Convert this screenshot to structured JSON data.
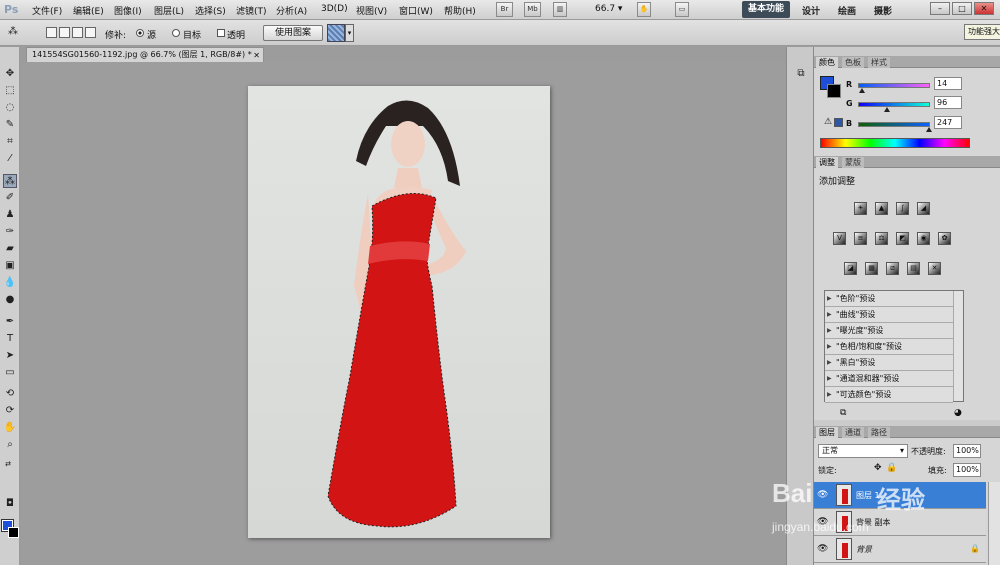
{
  "app": {
    "logo": "Ps"
  },
  "menu": [
    "文件(F)",
    "编辑(E)",
    "图像(I)",
    "图层(L)",
    "选择(S)",
    "滤镜(T)",
    "分析(A)",
    "3D(D)",
    "视图(V)",
    "窗口(W)",
    "帮助(H)"
  ],
  "menubar_icons": [
    "Br",
    "Mb"
  ],
  "zoom": "66.7",
  "workspaces": {
    "active": "基本功能",
    "others": [
      "设计",
      "绘画",
      "摄影"
    ]
  },
  "window_buttons": [
    "–",
    "□",
    "✕"
  ],
  "options": {
    "patch_label": "修补:",
    "source": "源",
    "target": "目标",
    "transparent": "透明",
    "use_pattern": "使用图案"
  },
  "tooltip": "功能强大",
  "document": {
    "tab": "141554SG01560-1192.jpg @ 66.7% (图层 1, RGB/8#) *",
    "close": "✕"
  },
  "colors": {
    "fg": "#1d4fd8",
    "bg": "#000000",
    "dress": "#d31414"
  },
  "color_panel": {
    "tabs": [
      "颜色",
      "色板",
      "样式"
    ],
    "r_label": "R",
    "g_label": "G",
    "b_label": "B",
    "r": "14",
    "g": "96",
    "b": "247"
  },
  "adjust_panel": {
    "tabs": [
      "调整",
      "蒙版"
    ],
    "title": "添加调整",
    "presets": [
      "\"色阶\"预设",
      "\"曲线\"预设",
      "\"曝光度\"预设",
      "\"色相/饱和度\"预设",
      "\"黑白\"预设",
      "\"通道混和器\"预设",
      "\"可选颜色\"预设"
    ]
  },
  "layers_panel": {
    "tabs": [
      "图层",
      "通道",
      "路径"
    ],
    "blend_mode": "正常",
    "opacity_label": "不透明度:",
    "opacity": "100%",
    "lock_label": "锁定:",
    "fill_label": "填充:",
    "fill": "100%",
    "layers": [
      "图层 1",
      "背景 副本",
      "背景"
    ]
  },
  "watermark": {
    "text": "Bai",
    "jy": "经验",
    "sub": "jingyan.baidu.com"
  }
}
